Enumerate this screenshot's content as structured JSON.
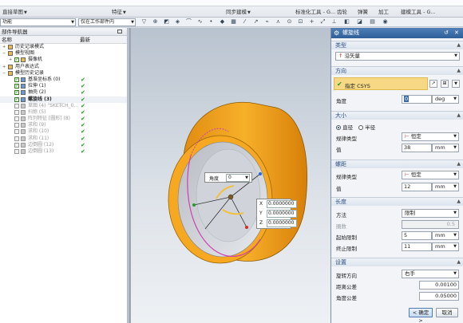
{
  "ribbon": {
    "groups": [
      "直接草图",
      "特征",
      "同步建模",
      "标准化工具 - G...",
      "齿轮",
      "弹簧",
      "加工",
      "建模工具 - G..."
    ]
  },
  "toolbar": {
    "filter_value": "功能",
    "scope_value": "仅在工作部件内"
  },
  "navigator": {
    "title": "部件导航器",
    "col_name": "名称",
    "col_latest": "最新",
    "rows": [
      {
        "label": "历史记录模式",
        "checked": false,
        "latest": false,
        "grey": false,
        "bold": false
      },
      {
        "label": "模型视图",
        "checked": false,
        "latest": false,
        "grey": false,
        "bold": false
      },
      {
        "label": "摄像机",
        "checked": true,
        "latest": false,
        "grey": false,
        "bold": false
      },
      {
        "label": "用户表达式",
        "checked": false,
        "latest": false,
        "grey": false,
        "bold": false
      },
      {
        "label": "模型历史记录",
        "checked": false,
        "latest": false,
        "grey": false,
        "bold": false
      },
      {
        "label": "基准坐标系 (0)",
        "checked": true,
        "latest": true,
        "grey": false,
        "bold": false
      },
      {
        "label": "拉伸 (1)",
        "checked": true,
        "latest": true,
        "grey": false,
        "bold": false
      },
      {
        "label": "抽壳 (2)",
        "checked": true,
        "latest": true,
        "grey": false,
        "bold": false
      },
      {
        "label": "螺旋线 (3)",
        "checked": true,
        "latest": true,
        "grey": false,
        "bold": true
      },
      {
        "label": "草图 (4) \"SKETCH_0...",
        "checked": false,
        "latest": true,
        "grey": true,
        "bold": false
      },
      {
        "label": "扫掠 (5)",
        "checked": false,
        "latest": true,
        "grey": true,
        "bold": false
      },
      {
        "label": "阵列特征 [圆形] (8)",
        "checked": false,
        "latest": true,
        "grey": true,
        "bold": false
      },
      {
        "label": "求和 (9)",
        "checked": false,
        "latest": true,
        "grey": true,
        "bold": false
      },
      {
        "label": "求和 (10)",
        "checked": false,
        "latest": true,
        "grey": true,
        "bold": false
      },
      {
        "label": "求和 (11)",
        "checked": false,
        "latest": true,
        "grey": true,
        "bold": false
      },
      {
        "label": "边倒圆 (12)",
        "checked": false,
        "latest": true,
        "grey": true,
        "bold": false
      },
      {
        "label": "边倒圆 (13)",
        "checked": false,
        "latest": true,
        "grey": true,
        "bold": false
      }
    ]
  },
  "viewport": {
    "angle_label": "角度",
    "angle_value": "0",
    "coords": [
      {
        "axis": "X",
        "value": "0.0000000"
      },
      {
        "axis": "Y",
        "value": "0.0000000"
      },
      {
        "axis": "Z",
        "value": "0.0000000"
      }
    ]
  },
  "dialog": {
    "title": "螺旋线",
    "type": {
      "header": "类型",
      "value": "沿矢量"
    },
    "direction": {
      "header": "方向",
      "csys_label": "指定 CSYS",
      "angle_label": "角度",
      "angle_value": "0",
      "angle_unit": "deg"
    },
    "size": {
      "header": "大小",
      "radio_diameter": "直径",
      "radio_radius": "半径",
      "law_label": "规律类型",
      "law_value": "恒定",
      "value_label": "值",
      "value": "38",
      "unit": "mm"
    },
    "pitch": {
      "header": "螺距",
      "law_label": "规律类型",
      "law_value": "恒定",
      "value_label": "值",
      "value": "12",
      "unit": "mm"
    },
    "length": {
      "header": "长度",
      "method_label": "方法",
      "method_value": "限制",
      "turns_label": "圈数",
      "turns_value": "0.5",
      "start_label": "起始限制",
      "start_value": "5",
      "end_label": "终止限制",
      "end_value": "11",
      "unit": "mm"
    },
    "settings": {
      "header": "设置",
      "rotation_label": "旋转方向",
      "rotation_value": "右手",
      "dist_tol_label": "距离公差",
      "dist_tol_value": "0.00100",
      "angle_tol_label": "角度公差",
      "angle_tol_value": "0.05000"
    },
    "ok_label": "< 确定 >",
    "cancel_label": "取消"
  },
  "colors": {
    "part": "#f0a020",
    "helix": "#d040b0",
    "dialog_title": "#3a6aa5",
    "section_text": "#2d4f86",
    "csys_highlight": "#f7d985",
    "check_green": "#1f9a1f"
  }
}
